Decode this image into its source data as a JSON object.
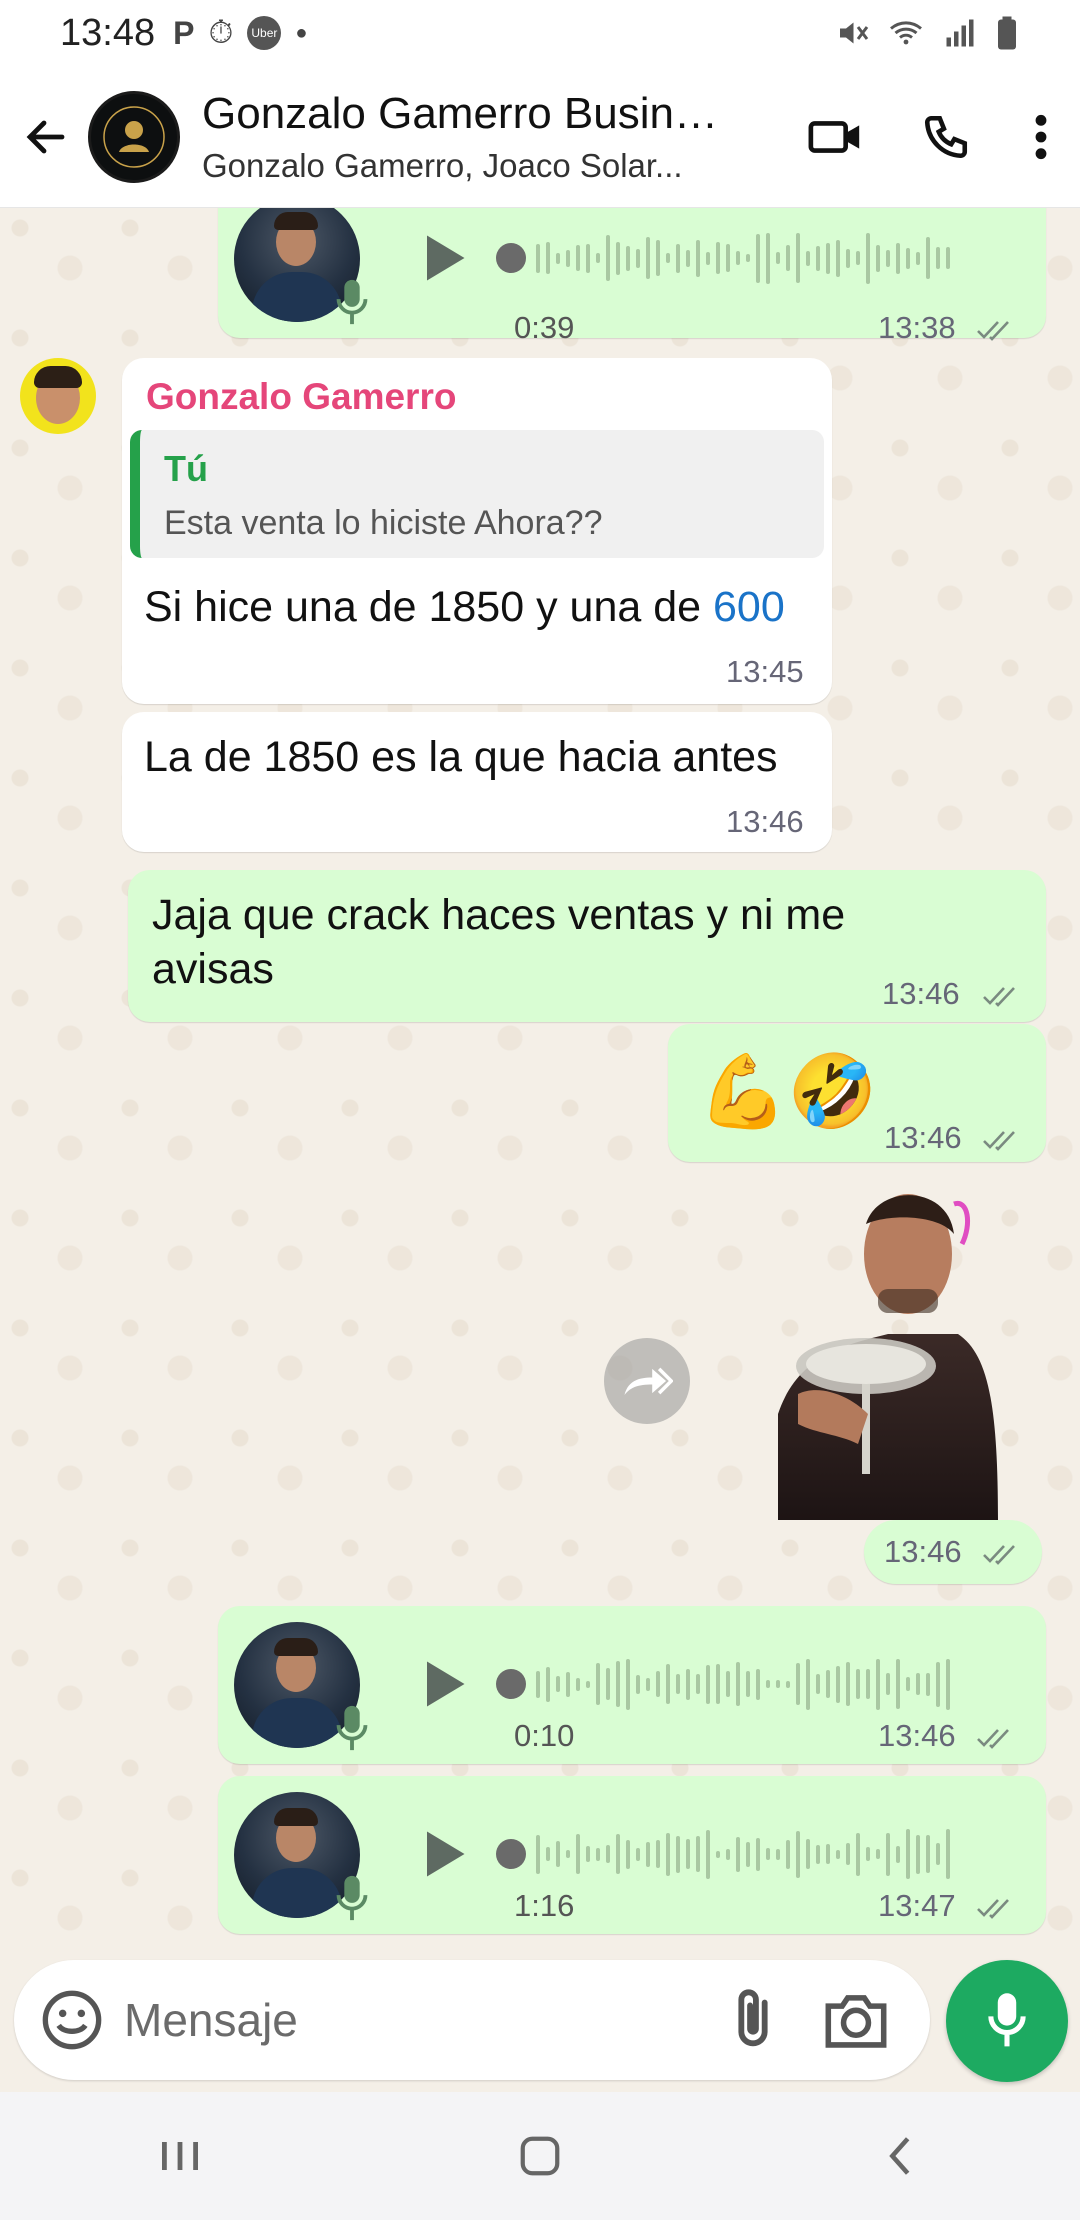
{
  "status_bar": {
    "time": "13:48",
    "left_icons": [
      "parking-icon",
      "stopwatch-icon",
      "uber-icon",
      "dot-icon"
    ],
    "uber_label": "Uber",
    "right_icons": [
      "mute-vibrate-icon",
      "wifi-icon",
      "signal-icon",
      "battery-icon"
    ]
  },
  "header": {
    "title": "Gonzalo Gamerro Business",
    "subtitle": "Gonzalo Gamerro, Joaco Solar...",
    "icons": [
      "back-arrow-icon",
      "video-call-icon",
      "phone-icon",
      "more-vert-icon"
    ]
  },
  "messages": {
    "vn1": {
      "duration": "0:39",
      "time": "13:38",
      "status": "read"
    },
    "m1": {
      "sender": "Gonzalo Gamerro",
      "quote_name": "Tú",
      "quote_text": "Esta venta lo hiciste Ahora??",
      "text_prefix": "Si hice una de 1850 y una de ",
      "text_link": "600",
      "time": "13:45"
    },
    "m2": {
      "text": "La de 1850 es la que hacia antes",
      "time": "13:46"
    },
    "m3": {
      "text_line1": "Jaja que crack haces ventas y ni me",
      "text_line2": "avisas",
      "time": "13:46",
      "status": "read"
    },
    "m4": {
      "text": "💪🤣",
      "time": "13:46",
      "status": "read"
    },
    "m5": {
      "type": "sticker",
      "time": "13:46",
      "status": "read"
    },
    "vn2": {
      "duration": "0:10",
      "time": "13:46",
      "status": "read"
    },
    "vn3": {
      "duration": "1:16",
      "time": "13:47",
      "status": "read"
    }
  },
  "composer": {
    "placeholder": "Mensaje",
    "icons": [
      "emoji-icon",
      "attach-icon",
      "camera-icon",
      "mic-icon"
    ]
  },
  "colors": {
    "outgoing_bubble": "#d9fdd3",
    "incoming_bubble": "#ffffff",
    "sender_name": "#e5467a",
    "quote_accent": "#25a14a",
    "fab": "#1daa61",
    "chat_bg": "#f4efe7"
  }
}
